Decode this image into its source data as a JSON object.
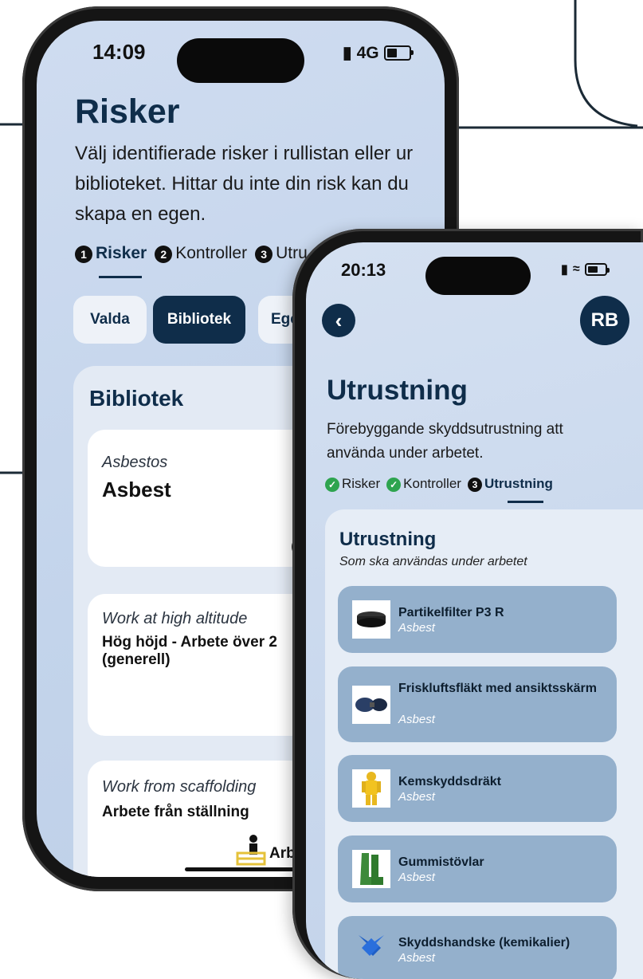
{
  "back_phone": {
    "status": {
      "time": "14:09",
      "network": "4G"
    },
    "title": "Risker",
    "description": "Välj identifierade risker i rullistan eller ur biblioteket.  Hittar du inte din risk kan du skapa en egen.",
    "steps": [
      {
        "number": "1",
        "label": "Risker",
        "active": true
      },
      {
        "number": "2",
        "label": "Kontroller",
        "active": false
      },
      {
        "number": "3",
        "label": "Utru",
        "active": false
      }
    ],
    "tabs": [
      {
        "label": "Valda",
        "selected": false
      },
      {
        "label": "Bibliotek",
        "selected": true
      },
      {
        "label": "Egen",
        "selected": false
      }
    ],
    "library": {
      "heading": "Bibliotek",
      "items": [
        {
          "subtitle": "Asbestos",
          "title": "Asbest"
        },
        {
          "subtitle": "Work at high altitude",
          "title": "Hög höjd - Arbete över 2 (generell)"
        },
        {
          "subtitle": "Work from scaffolding",
          "title": "Arbete från ställning",
          "tag": "Arbe"
        }
      ]
    }
  },
  "front_phone": {
    "status": {
      "time": "20:13"
    },
    "avatar": "RB",
    "title": "Utrustning",
    "description": "Förebyggande skyddsutrustning att använda under arbetet.",
    "steps": [
      {
        "label": "Risker",
        "state": "done"
      },
      {
        "label": "Kontroller",
        "state": "done"
      },
      {
        "number": "3",
        "label": "Utrustning",
        "state": "active"
      }
    ],
    "equipment": {
      "heading": "Utrustning",
      "subheading": "Som ska användas under arbetet",
      "items": [
        {
          "name": "Partikelfilter P3 R",
          "risk": "Asbest",
          "icon": "filter-cartridge-icon"
        },
        {
          "name": "Friskluftsfläkt med ansiktsskärm",
          "risk": "Asbest",
          "icon": "respirator-icon"
        },
        {
          "name": "Kemskyddsdräkt",
          "risk": "Asbest",
          "icon": "chemical-suit-icon"
        },
        {
          "name": "Gummistövlar",
          "risk": "Asbest",
          "icon": "rubber-boots-icon"
        },
        {
          "name": "Skyddshandske (kemikalier)",
          "risk": "Asbest",
          "icon": "gloves-icon"
        }
      ]
    }
  },
  "colors": {
    "primary": "#0f2d4a",
    "screen_bg": "#c9d8ed",
    "equip_item_bg": "#94b0cc",
    "check_green": "#2ea44f"
  }
}
